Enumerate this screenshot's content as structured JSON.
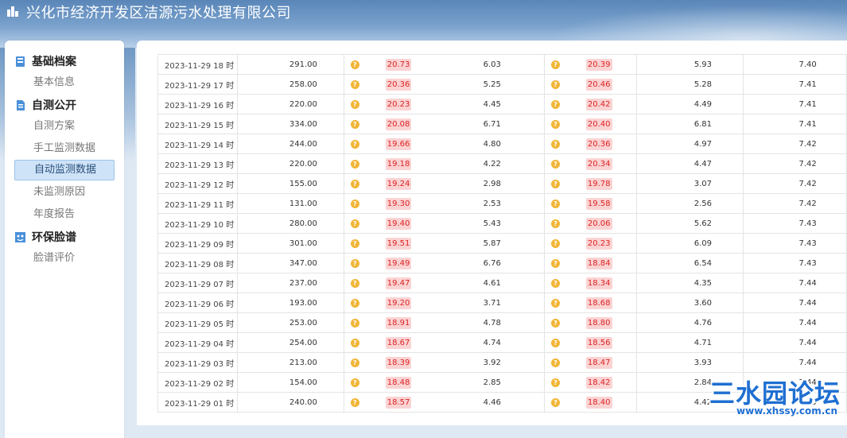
{
  "header": {
    "title": "兴化市经济开发区洁源污水处理有限公司"
  },
  "sidebar": {
    "sections": [
      {
        "label": "基础档案",
        "icon": "archive-icon",
        "items": [
          "基本信息"
        ]
      },
      {
        "label": "自测公开",
        "icon": "document-icon",
        "items": [
          "自测方案",
          "手工监测数据",
          "自动监测数据",
          "未监测原因",
          "年度报告"
        ]
      },
      {
        "label": "环保脸谱",
        "icon": "profile-icon",
        "items": [
          "脸谱评价"
        ]
      }
    ],
    "active_item": "自动监测数据"
  },
  "table": {
    "rows": [
      {
        "time": "2023-11-29 18 时",
        "flow": "291.00",
        "a": "20.73",
        "b": "6.03",
        "c": "20.39",
        "d": "5.93",
        "e": "7.40"
      },
      {
        "time": "2023-11-29 17 时",
        "flow": "258.00",
        "a": "20.36",
        "b": "5.25",
        "c": "20.46",
        "d": "5.28",
        "e": "7.41"
      },
      {
        "time": "2023-11-29 16 时",
        "flow": "220.00",
        "a": "20.23",
        "b": "4.45",
        "c": "20.42",
        "d": "4.49",
        "e": "7.41"
      },
      {
        "time": "2023-11-29 15 时",
        "flow": "334.00",
        "a": "20.08",
        "b": "6.71",
        "c": "20.40",
        "d": "6.81",
        "e": "7.41"
      },
      {
        "time": "2023-11-29 14 时",
        "flow": "244.00",
        "a": "19.66",
        "b": "4.80",
        "c": "20.36",
        "d": "4.97",
        "e": "7.42"
      },
      {
        "time": "2023-11-29 13 时",
        "flow": "220.00",
        "a": "19.18",
        "b": "4.22",
        "c": "20.34",
        "d": "4.47",
        "e": "7.42"
      },
      {
        "time": "2023-11-29 12 时",
        "flow": "155.00",
        "a": "19.24",
        "b": "2.98",
        "c": "19.78",
        "d": "3.07",
        "e": "7.42"
      },
      {
        "time": "2023-11-29 11 时",
        "flow": "131.00",
        "a": "19.30",
        "b": "2.53",
        "c": "19.58",
        "d": "2.56",
        "e": "7.42"
      },
      {
        "time": "2023-11-29 10 时",
        "flow": "280.00",
        "a": "19.40",
        "b": "5.43",
        "c": "20.06",
        "d": "5.62",
        "e": "7.43"
      },
      {
        "time": "2023-11-29 09 时",
        "flow": "301.00",
        "a": "19.51",
        "b": "5.87",
        "c": "20.23",
        "d": "6.09",
        "e": "7.43"
      },
      {
        "time": "2023-11-29 08 时",
        "flow": "347.00",
        "a": "19.49",
        "b": "6.76",
        "c": "18.84",
        "d": "6.54",
        "e": "7.43"
      },
      {
        "time": "2023-11-29 07 时",
        "flow": "237.00",
        "a": "19.47",
        "b": "4.61",
        "c": "18.34",
        "d": "4.35",
        "e": "7.44"
      },
      {
        "time": "2023-11-29 06 时",
        "flow": "193.00",
        "a": "19.20",
        "b": "3.71",
        "c": "18.68",
        "d": "3.60",
        "e": "7.44"
      },
      {
        "time": "2023-11-29 05 时",
        "flow": "253.00",
        "a": "18.91",
        "b": "4.78",
        "c": "18.80",
        "d": "4.76",
        "e": "7.44"
      },
      {
        "time": "2023-11-29 04 时",
        "flow": "254.00",
        "a": "18.67",
        "b": "4.74",
        "c": "18.56",
        "d": "4.71",
        "e": "7.44"
      },
      {
        "time": "2023-11-29 03 时",
        "flow": "213.00",
        "a": "18.39",
        "b": "3.92",
        "c": "18.47",
        "d": "3.93",
        "e": "7.44"
      },
      {
        "time": "2023-11-29 02 时",
        "flow": "154.00",
        "a": "18.48",
        "b": "2.85",
        "c": "18.42",
        "d": "2.84",
        "e": "7.44"
      },
      {
        "time": "2023-11-29 01 时",
        "flow": "240.00",
        "a": "18.57",
        "b": "4.46",
        "c": "18.40",
        "d": "4.42",
        "e": "7.45"
      }
    ]
  },
  "watermark": {
    "cn": "三水园论坛",
    "url": "www.xhssy.com.cn"
  },
  "colors": {
    "badge_bg": "#fbd3d3",
    "badge_text": "#dd2222",
    "warn_icon": "#f2b536",
    "active_nav": "#cfe3f8"
  }
}
